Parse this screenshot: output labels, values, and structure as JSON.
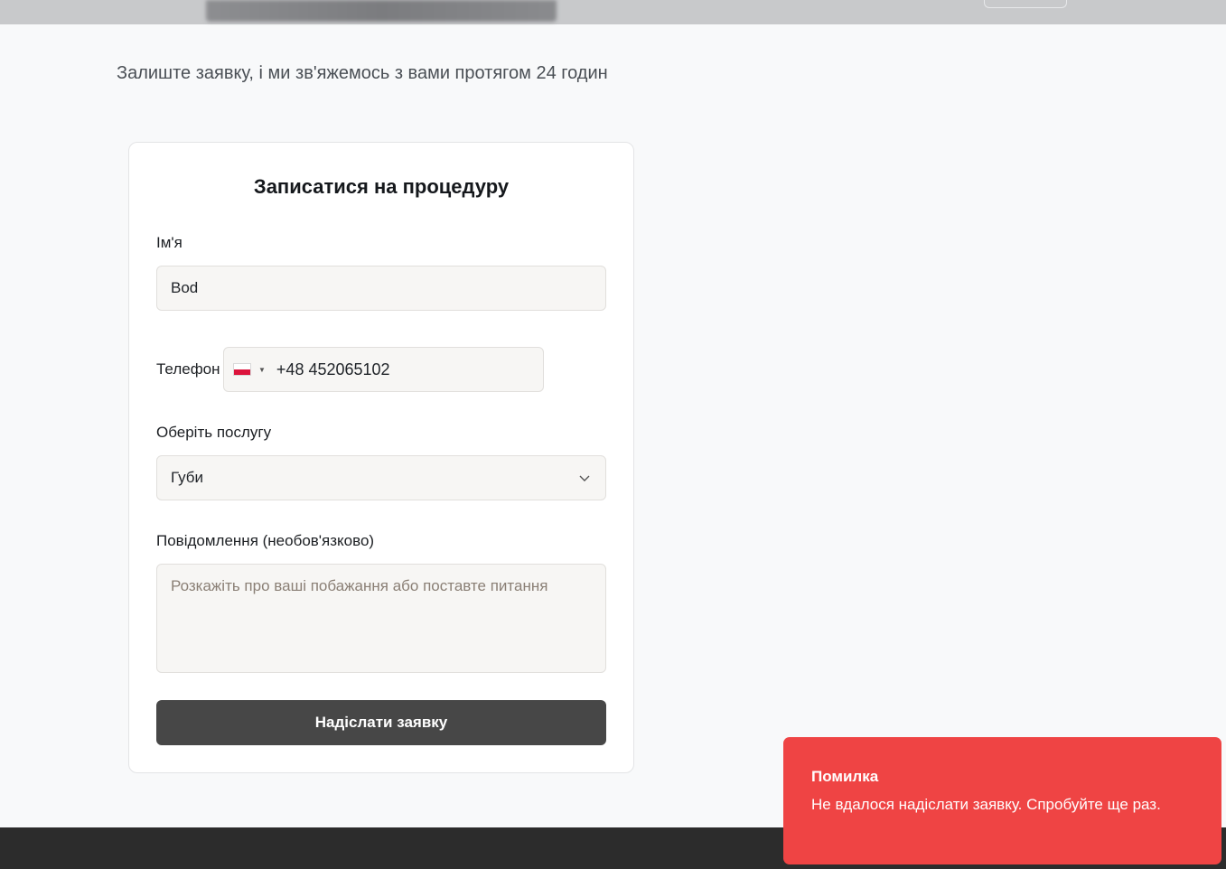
{
  "header": {},
  "subtitle": "Залиште заявку, і ми зв'яжемось з вами протягом 24 годин",
  "form": {
    "title": "Записатися на процедуру",
    "name_label": "Ім'я",
    "name_value": "Bod",
    "phone_label": "Телефон",
    "phone_country": "PL",
    "phone_value": "+48 452065102",
    "service_label": "Оберіть послугу",
    "service_value": "Губи",
    "message_label": "Повідомлення (необов'язково)",
    "message_placeholder": "Розкажіть про ваші побажання або поставте питання",
    "submit_label": "Надіслати заявку"
  },
  "toast": {
    "title": "Помилка",
    "message": "Не вдалося надіслати заявку. Спробуйте ще раз.",
    "color": "#ef4444"
  },
  "colors": {
    "button": "#474747",
    "footer": "#2c2c2c",
    "input_bg": "#f7f6f4"
  }
}
